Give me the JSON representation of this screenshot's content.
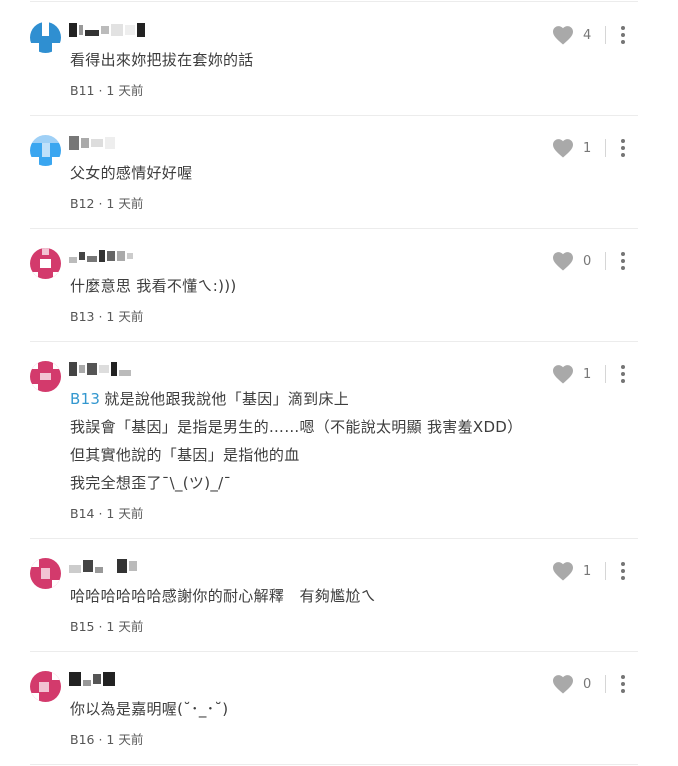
{
  "comments": [
    {
      "floor": "B11",
      "time": "1 天前",
      "likes": "4",
      "lines": [
        "看得出來妳把拔在套妳的話"
      ],
      "reply_to": "",
      "avatar_color": "#2f8fd1"
    },
    {
      "floor": "B12",
      "time": "1 天前",
      "likes": "1",
      "lines": [
        "父女的感情好好喔"
      ],
      "reply_to": "",
      "avatar_color": "#3aa6f0"
    },
    {
      "floor": "B13",
      "time": "1 天前",
      "likes": "0",
      "lines": [
        "什麼意思 我看不懂ㄟ:)))"
      ],
      "reply_to": "",
      "avatar_color": "#d33a6c"
    },
    {
      "floor": "B14",
      "time": "1 天前",
      "likes": "1",
      "lines": [
        "就是說他跟我說他「基因」滴到床上",
        "我誤會「基因」是指是男生的……嗯（不能說太明顯 我害羞XDD）",
        "但其實他說的「基因」是指他的血",
        "我完全想歪了¯\\_(ツ)_/¯"
      ],
      "reply_to": "B13",
      "avatar_color": "#d33a6c"
    },
    {
      "floor": "B15",
      "time": "1 天前",
      "likes": "1",
      "lines": [
        "哈哈哈哈哈哈感謝你的耐心解釋　有夠尷尬ㄟ"
      ],
      "reply_to": "",
      "avatar_color": "#d33a6c"
    },
    {
      "floor": "B16",
      "time": "1 天前",
      "likes": "0",
      "lines": [
        "你以為是嘉明喔(˘･_･˘)"
      ],
      "reply_to": "",
      "avatar_color": "#d33a6c"
    }
  ],
  "meta_separator": "·",
  "icons": {
    "like": "heart-icon",
    "more": "more-vertical-icon"
  }
}
